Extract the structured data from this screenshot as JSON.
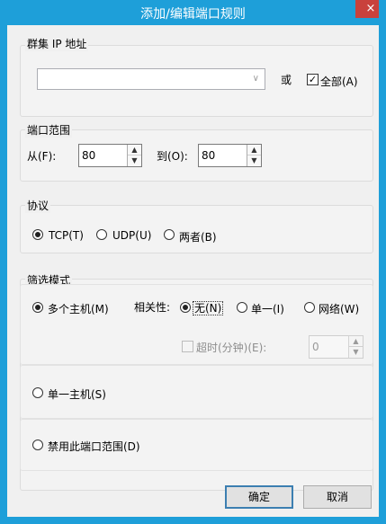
{
  "window": {
    "title": "添加/编辑端口规则",
    "close_glyph": "×"
  },
  "cluster_ip": {
    "group_label": "群集 IP 地址",
    "input_value": "",
    "or_label": "或",
    "all_checked": true,
    "all_label": "全部(A)"
  },
  "port_range": {
    "group_label": "端口范围",
    "from_label": "从(F):",
    "from_value": "80",
    "to_label": "到(O):",
    "to_value": "80"
  },
  "protocol": {
    "group_label": "协议",
    "options": [
      {
        "label": "TCP(T)",
        "selected": true
      },
      {
        "label": "UDP(U)",
        "selected": false
      },
      {
        "label": "两者(B)",
        "selected": false
      }
    ]
  },
  "filter_mode": {
    "group_label": "筛选模式",
    "multiple_host_label": "多个主机(M)",
    "multiple_host_selected": true,
    "affinity_label": "相关性:",
    "affinity_options": [
      {
        "label": "无(N)",
        "selected": true
      },
      {
        "label": "单一(I)",
        "selected": false
      },
      {
        "label": "网络(W)",
        "selected": false
      }
    ],
    "timeout_label": "超时(分钟)(E):",
    "timeout_checked": false,
    "timeout_value": "0",
    "single_host_label": "单一主机(S)",
    "single_host_selected": false,
    "disable_label": "禁用此端口范围(D)",
    "disable_selected": false
  },
  "buttons": {
    "ok": "确定",
    "cancel": "取消"
  },
  "icons": {
    "combo_arrow": "chevron-down-icon",
    "spin_up": "chevron-up-icon",
    "spin_down": "chevron-down-icon"
  }
}
